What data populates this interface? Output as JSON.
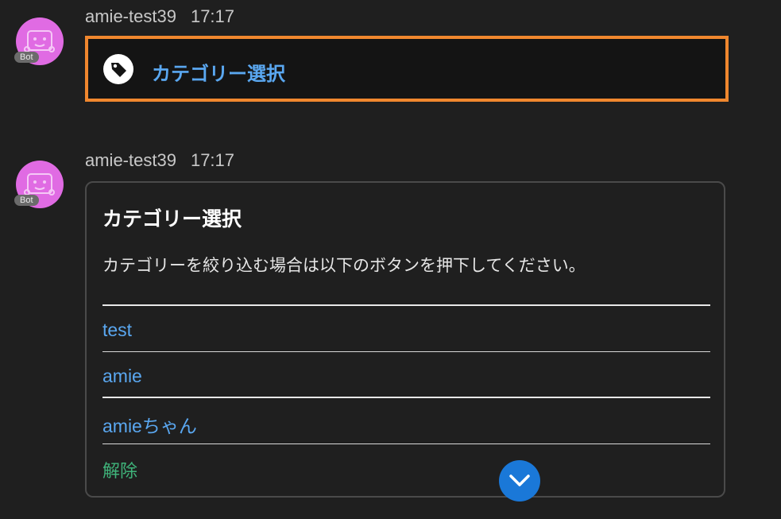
{
  "messages": [
    {
      "sender": "amie-test39",
      "time": "17:17",
      "badge": "Bot",
      "collapsed_card": {
        "icon": "tag-icon",
        "title": "カテゴリー選択"
      }
    },
    {
      "sender": "amie-test39",
      "time": "17:17",
      "badge": "Bot",
      "card": {
        "title": "カテゴリー選択",
        "description": "カテゴリーを絞り込む場合は以下のボタンを押下してください。",
        "options": [
          "test",
          "amie",
          "amieちゃん"
        ],
        "clear_label": "解除"
      }
    }
  ],
  "scroll_button": {
    "icon": "chevron-down-icon"
  },
  "colors": {
    "background": "#1f1f1f",
    "accent_link": "#5aa7f0",
    "clear_green": "#3fb37a",
    "highlight_orange": "#f0872e",
    "avatar_pink": "#e06be3",
    "scroll_button_blue": "#1a78d8"
  }
}
